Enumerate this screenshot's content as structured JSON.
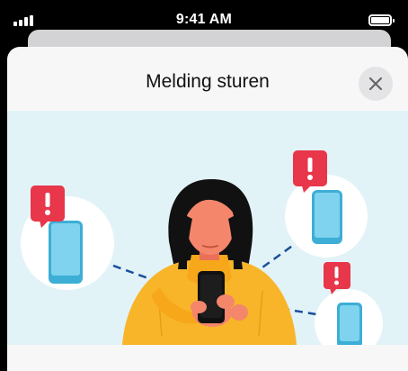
{
  "status_bar": {
    "time": "9:41 AM",
    "icons": [
      "signal-icon",
      "battery-icon"
    ]
  },
  "sheet": {
    "title": "Melding sturen",
    "close_icon": "close-icon"
  },
  "illustration": {
    "description_icons": [
      "alert-icon",
      "smartphone-icon",
      "person-with-phone"
    ]
  },
  "colors": {
    "alert_red": "#e8364a",
    "phone_blue": "#6ecbe8",
    "sweater_yellow": "#f8b52a",
    "skin": "#f4866c",
    "hair": "#111111",
    "background_tint": "#e2f3f7",
    "dash_line": "#1b4f9c"
  }
}
